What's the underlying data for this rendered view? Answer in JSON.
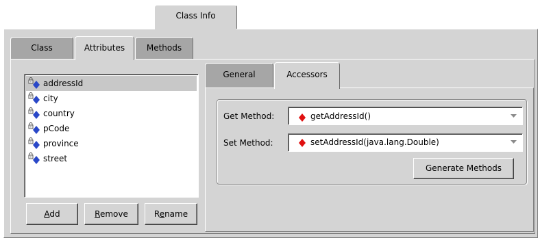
{
  "window": {
    "top_tab": "Class Info"
  },
  "inner_tabs": [
    {
      "label": "Class"
    },
    {
      "label": "Attributes"
    },
    {
      "label": "Methods"
    }
  ],
  "attributes": {
    "items": [
      {
        "name": "addressId",
        "selected": true
      },
      {
        "name": "city",
        "selected": false
      },
      {
        "name": "country",
        "selected": false
      },
      {
        "name": "pCode",
        "selected": false
      },
      {
        "name": "province",
        "selected": false
      },
      {
        "name": "street",
        "selected": false
      }
    ],
    "buttons": {
      "add": {
        "mnemonic": "A",
        "rest": "dd"
      },
      "remove": {
        "mnemonic": "R",
        "rest": "emove"
      },
      "rename": {
        "pre": "R",
        "mnemonic": "e",
        "rest": "name"
      }
    }
  },
  "detail_tabs": [
    {
      "label": "General"
    },
    {
      "label": "Accessors"
    }
  ],
  "accessors": {
    "get_label": "Get Method:",
    "get_value": "getAddressId()",
    "set_label": "Set Method:",
    "set_value": "setAddressId(java.lang.Double)",
    "generate_label": "Generate Methods"
  },
  "colors": {
    "panel": "#d4d4d4",
    "selection": "#c8c8c8",
    "attribute_icon": "#2a48c8",
    "method_icon": "#e01010"
  }
}
